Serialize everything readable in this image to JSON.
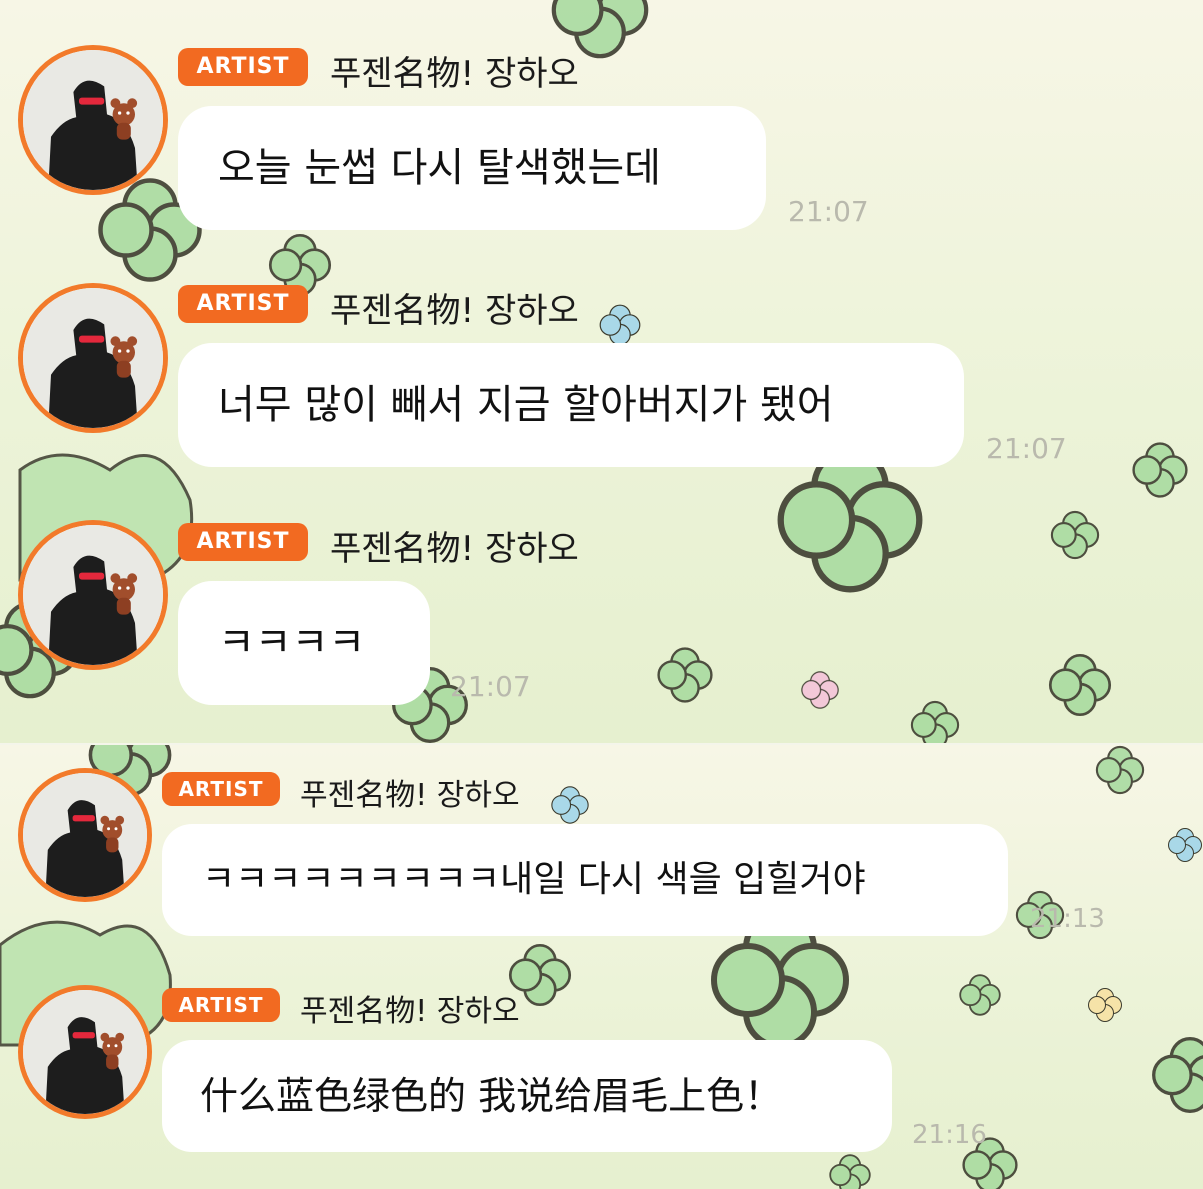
{
  "badge_label": "ARTIST",
  "colors": {
    "accent": "#f26a21",
    "clover": "#a9dba0",
    "clover_stroke": "#3b3b2e"
  },
  "messages": [
    {
      "sender": "푸젠名物! 장하오",
      "text": "오늘 눈썹 다시 탈색했는데",
      "time": "21:07"
    },
    {
      "sender": "푸젠名物! 장하오",
      "text": "너무 많이 빼서 지금 할아버지가 됐어",
      "time": "21:07"
    },
    {
      "sender": "푸젠名物! 장하오",
      "text": "ㅋㅋㅋㅋ",
      "time": "21:07"
    },
    {
      "sender": "푸젠名物! 장하오",
      "text": "ㅋㅋㅋㅋㅋㅋㅋㅋㅋ내일 다시 색을 입힐거야",
      "time": "21:13"
    },
    {
      "sender": "푸젠名物! 장하오",
      "text": "什么蓝色绿色的 我说给眉毛上色！",
      "time": "21:16"
    }
  ],
  "icons": {
    "avatar": "profile-photo-with-red-panda-plush-icon",
    "background": "clover-pattern"
  }
}
